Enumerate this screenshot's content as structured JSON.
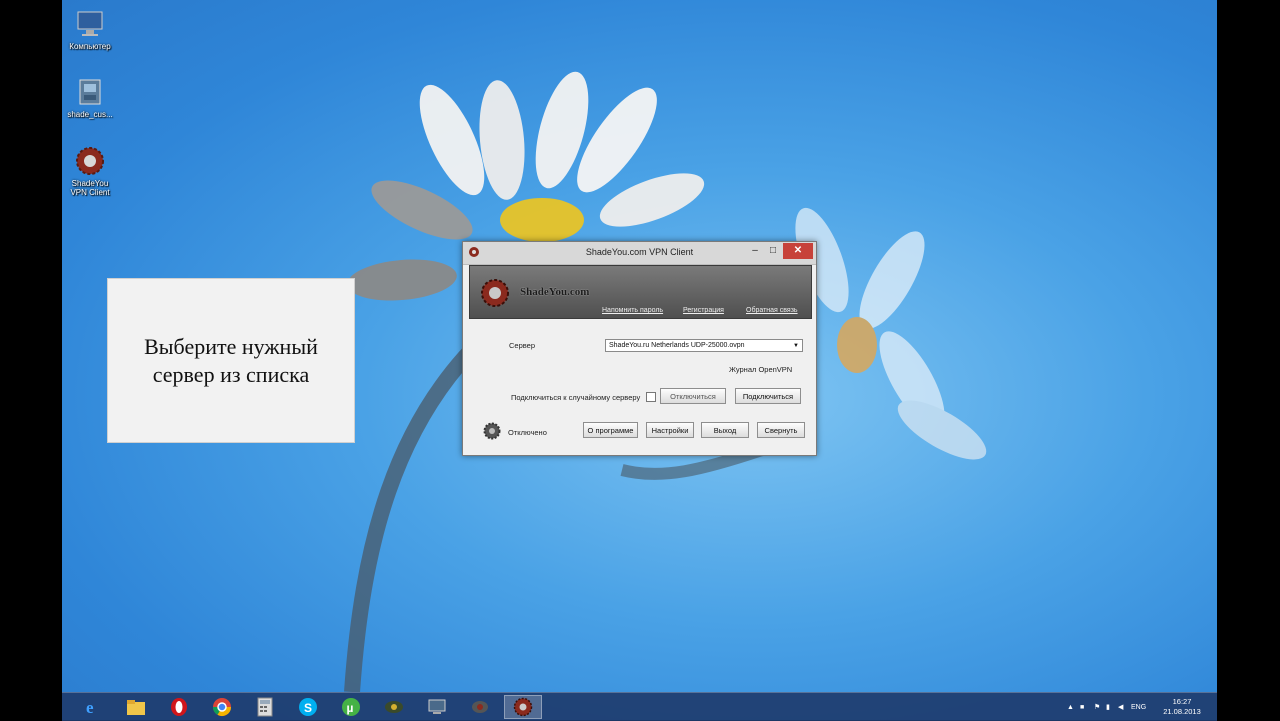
{
  "desktop": {
    "icons": [
      {
        "label": "Компьютер"
      },
      {
        "label": "shade_cus..."
      },
      {
        "label": "ShadeYou\nVPN Client"
      }
    ]
  },
  "caption": {
    "text": "Выберите нужный\nсервер из списка"
  },
  "vpn_window": {
    "title": "ShadeYou.com VPN Client",
    "brand": "ShadeYou.com",
    "links": {
      "restore": "Напомнить пароль",
      "register": "Регистрация",
      "feedback": "Обратная связь"
    },
    "server_label": "Сервер",
    "server_value": "ShadeYou.ru Netherlands UDP-25000.ovpn",
    "log_link": "Журнал OpenVPN",
    "random_label": "Подключиться к случайному серверу",
    "random_checked": false,
    "disconnect_button": "Отключиться",
    "connect_button": "Подключиться",
    "status": "Отключено",
    "about_button": "О программе",
    "settings_button": "Настройки",
    "exit_button": "Выход",
    "minimize_button": "Свернуть",
    "controls": {
      "minimize": "–",
      "maximize": "□",
      "close": "✕"
    }
  },
  "taskbar": {
    "items": [
      "ie-icon",
      "file-explorer-icon",
      "opera-icon",
      "chrome-icon",
      "calculator-icon",
      "skype-icon",
      "utorrent-icon",
      "vpn-app-icon",
      "network-app-icon",
      "vpn-tray-app-icon",
      "shadeyou-vpn-icon"
    ],
    "active_item": "shadeyou-vpn-icon",
    "language": "ENG",
    "time": "16:27",
    "date": "21.08.2013"
  },
  "colors": {
    "accent_close": "#c7423a",
    "taskbar": "#1e3c6e",
    "logo_red": "#8b2a1e"
  }
}
